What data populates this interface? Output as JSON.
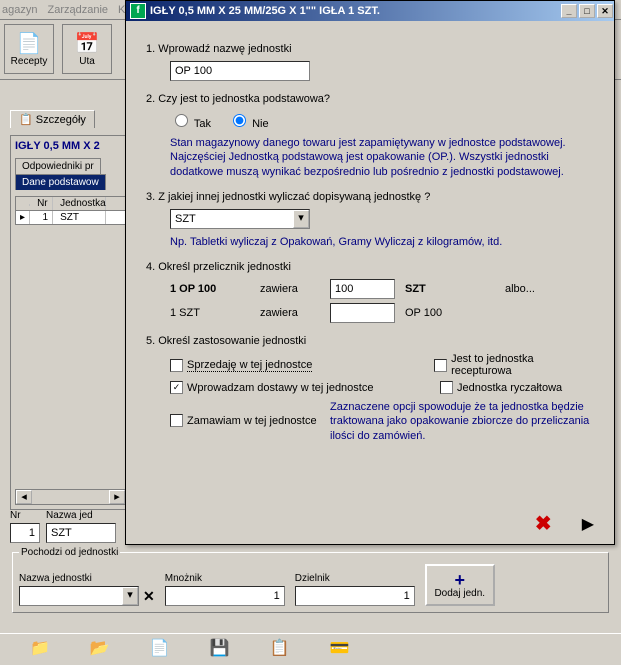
{
  "bg": {
    "menu": [
      "agazyn",
      "Zarządzanie",
      "K"
    ],
    "toolbar": [
      {
        "label": "Recepty",
        "icon": "📄"
      },
      {
        "label": "Uta",
        "icon": "📅"
      }
    ],
    "tab_details": "Szczegóły",
    "panel_title": "IGŁY 0,5 MM X 2",
    "section_tabs": [
      "Odpowiedniki pr",
      "Dane podstawow"
    ],
    "table": {
      "headers": [
        "",
        "Nr",
        "Jednostka"
      ],
      "row": {
        "marker": "▸",
        "nr": "1",
        "unit": "SZT"
      }
    }
  },
  "dialog": {
    "title": "IGŁY 0,5 MM X 25 MM/25G X 1\"\" IGŁA 1 SZT.",
    "q1": "1. Wprowadź nazwę jednostki",
    "q1_value": "OP 100",
    "q2": "2. Czy jest to jednostka podstawowa?",
    "q2_yes": "Tak",
    "q2_no": "Nie",
    "q2_hint": "Stan magazynowy danego towaru jest zapamiętywany w jednostce podstawowej. Najczęściej Jednostką podstawową jest opakowanie (OP.). Wszystki jednostki dodatkowe muszą wynikać bezpośrednio lub pośrednio z jednostki podstawowej.",
    "q3": "3. Z jakiej innej jednostki wyliczać dopisywaną jednostkę ?",
    "q3_value": "SZT",
    "q3_hint": "Np. Tabletki wyliczaj z Opakowań, Gramy Wyliczaj z kilogramów, itd.",
    "q4": "4. Określ przelicznik jednostki",
    "q4_r1_c1": "1 OP 100",
    "q4_zawiera": "zawiera",
    "q4_r1_val": "100",
    "q4_r1_unit": "SZT",
    "q4_albo": "albo...",
    "q4_r2_c1": "1 SZT",
    "q4_r2_val": "",
    "q4_r2_unit": "OP 100",
    "q5": "5. Określ zastosowanie jednostki",
    "chk1": "Sprzedaję w tej jednostce",
    "chk2": "Jest to jednostka recepturowa",
    "chk3": "Wprowadzam dostawy w tej jednostce",
    "chk4": "Jednostka ryczałtowa",
    "chk5": "Zamawiam w tej jednostce",
    "chk5_note": "Zaznaczene opcji spowoduje że ta jednostka będzie traktowana jako opakowanie zbiorcze do przeliczania ilości do zamówień."
  },
  "lower": {
    "nr_label": "Nr",
    "nr_value": "1",
    "nazwa_label": "Nazwa jed",
    "nazwa_value": "SZT",
    "group_label": "Pochodzi od jednostki",
    "col1_label": "Nazwa  jednostki",
    "col1_value": "",
    "mnoznik_label": "Mnożnik",
    "mnoznik_value": "1",
    "dzielnik_label": "Dzielnik",
    "dzielnik_value": "1",
    "add_label": "Dodaj jedn."
  }
}
